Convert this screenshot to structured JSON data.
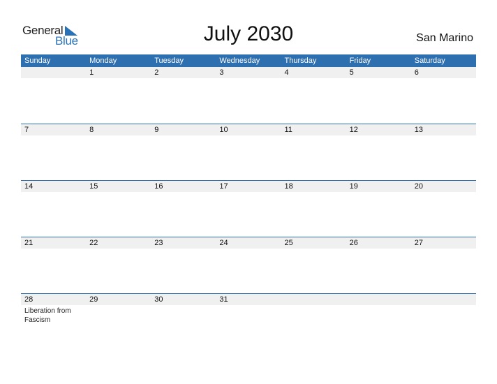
{
  "logo": {
    "line1": "General",
    "line2": "Blue",
    "accent": "#2a72b8"
  },
  "title": "July 2030",
  "country": "San Marino",
  "header_color": "#2e6fb0",
  "weekdays": [
    "Sunday",
    "Monday",
    "Tuesday",
    "Wednesday",
    "Thursday",
    "Friday",
    "Saturday"
  ],
  "weeks": [
    {
      "days": [
        "",
        "1",
        "2",
        "3",
        "4",
        "5",
        "6"
      ],
      "events": [
        "",
        "",
        "",
        "",
        "",
        "",
        ""
      ]
    },
    {
      "days": [
        "7",
        "8",
        "9",
        "10",
        "11",
        "12",
        "13"
      ],
      "events": [
        "",
        "",
        "",
        "",
        "",
        "",
        ""
      ]
    },
    {
      "days": [
        "14",
        "15",
        "16",
        "17",
        "18",
        "19",
        "20"
      ],
      "events": [
        "",
        "",
        "",
        "",
        "",
        "",
        ""
      ]
    },
    {
      "days": [
        "21",
        "22",
        "23",
        "24",
        "25",
        "26",
        "27"
      ],
      "events": [
        "",
        "",
        "",
        "",
        "",
        "",
        ""
      ]
    },
    {
      "days": [
        "28",
        "29",
        "30",
        "31",
        "",
        "",
        ""
      ],
      "events": [
        "Liberation from Fascism",
        "",
        "",
        "",
        "",
        "",
        ""
      ]
    }
  ]
}
